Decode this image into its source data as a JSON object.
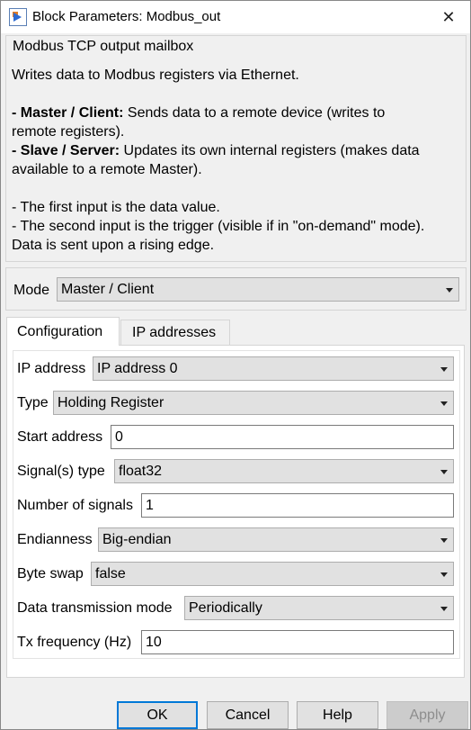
{
  "window": {
    "title": "Block Parameters: Modbus_out"
  },
  "description": {
    "group_title": "Modbus TCP output mailbox",
    "line1": "Writes data to Modbus registers via Ethernet.",
    "master_bold": "- Master / Client:",
    "master_text": " Sends data to a remote device (writes to",
    "master_text2": "remote registers).",
    "slave_bold": "- Slave / Server:",
    "slave_text": " Updates its own internal registers (makes data",
    "slave_text2": "available to a remote Master).",
    "input1": "- The first input is the data value.",
    "input2": "- The second input is the trigger (visible if in \"on-demand\" mode).",
    "input3": "Data is sent upon a rising edge."
  },
  "mode": {
    "label": "Mode",
    "value": "Master / Client"
  },
  "tabs": [
    {
      "label": "Configuration",
      "active": true
    },
    {
      "label": "IP addresses",
      "active": false
    }
  ],
  "config": {
    "ip_address": {
      "label": "IP address",
      "value": "IP address 0"
    },
    "type": {
      "label": "Type",
      "value": "Holding Register"
    },
    "start_address": {
      "label": "Start address",
      "value": "0"
    },
    "signal_type": {
      "label": "Signal(s) type",
      "value": "float32"
    },
    "num_signals": {
      "label": "Number of signals",
      "value": "1"
    },
    "endianness": {
      "label": "Endianness",
      "value": "Big-endian"
    },
    "byte_swap": {
      "label": "Byte swap",
      "value": "false"
    },
    "tx_mode": {
      "label": "Data transmission mode",
      "value": "Periodically"
    },
    "tx_freq": {
      "label": "Tx frequency (Hz)",
      "value": "10"
    }
  },
  "buttons": {
    "ok": "OK",
    "cancel": "Cancel",
    "help": "Help",
    "apply": "Apply"
  },
  "icons": {
    "app": "simulink-block-icon",
    "close": "close-icon",
    "dropdown": "chevron-down-icon"
  },
  "colors": {
    "accent": "#0078d7",
    "dialog_bg": "#f0f0f0",
    "panel_bg": "#ffffff"
  }
}
